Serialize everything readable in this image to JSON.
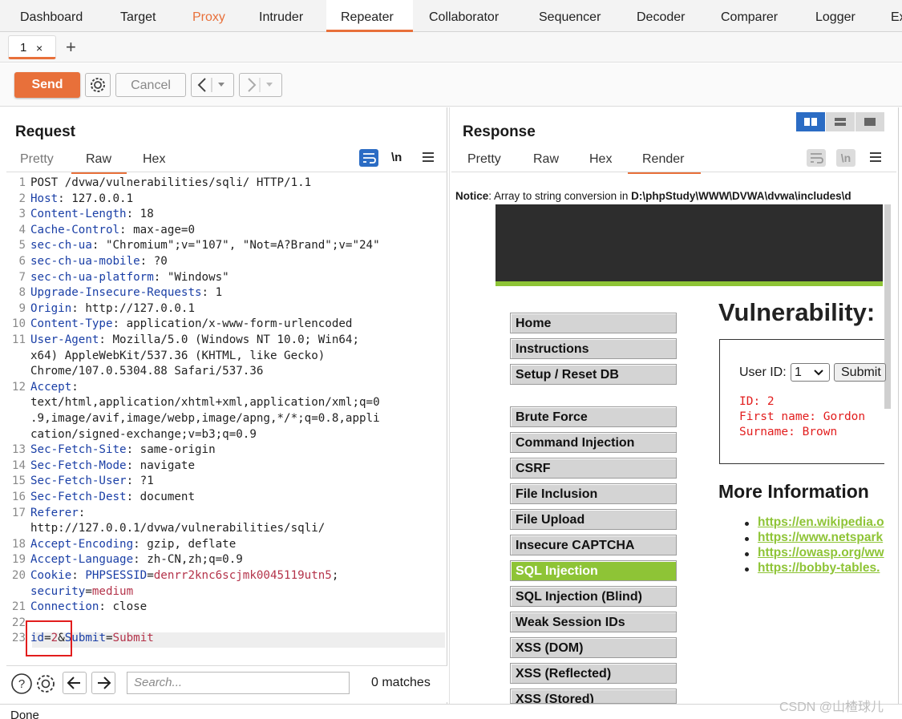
{
  "top_tabs": [
    "Dashboard",
    "Target",
    "Proxy",
    "Intruder",
    "Repeater",
    "Collaborator",
    "Sequencer",
    "Decoder",
    "Comparer",
    "Logger",
    "Ex"
  ],
  "sub_tab": {
    "label": "1",
    "close": "×",
    "add": "+"
  },
  "toolbar": {
    "send": "Send",
    "cancel": "Cancel"
  },
  "request": {
    "title": "Request",
    "tabs": [
      "Pretty",
      "Raw",
      "Hex"
    ],
    "active_tab": "Raw",
    "newline_toggle": "\\n",
    "lines": [
      {
        "n": "1",
        "segs": [
          {
            "t": "POST /dvwa/vulnerabilities/sqli/ HTTP/1.1",
            "c": "hv"
          }
        ]
      },
      {
        "n": "2",
        "segs": [
          {
            "t": "Host",
            "c": "hk"
          },
          {
            "t": ": 127.0.0.1",
            "c": "hv"
          }
        ]
      },
      {
        "n": "3",
        "segs": [
          {
            "t": "Content-Length",
            "c": "hk"
          },
          {
            "t": ": 18",
            "c": "hv"
          }
        ]
      },
      {
        "n": "4",
        "segs": [
          {
            "t": "Cache-Control",
            "c": "hk"
          },
          {
            "t": ": max-age=0",
            "c": "hv"
          }
        ]
      },
      {
        "n": "5",
        "segs": [
          {
            "t": "sec-ch-ua",
            "c": "hk"
          },
          {
            "t": ": \"Chromium\";v=\"107\", \"Not=A?Brand\";v=\"24\"",
            "c": "hv"
          }
        ]
      },
      {
        "n": "6",
        "segs": [
          {
            "t": "sec-ch-ua-mobile",
            "c": "hk"
          },
          {
            "t": ": ?0",
            "c": "hv"
          }
        ]
      },
      {
        "n": "7",
        "segs": [
          {
            "t": "sec-ch-ua-platform",
            "c": "hk"
          },
          {
            "t": ": \"Windows\"",
            "c": "hv"
          }
        ]
      },
      {
        "n": "8",
        "segs": [
          {
            "t": "Upgrade-Insecure-Requests",
            "c": "hk"
          },
          {
            "t": ": 1",
            "c": "hv"
          }
        ]
      },
      {
        "n": "9",
        "segs": [
          {
            "t": "Origin",
            "c": "hk"
          },
          {
            "t": ": http://127.0.0.1",
            "c": "hv"
          }
        ]
      },
      {
        "n": "10",
        "segs": [
          {
            "t": "Content-Type",
            "c": "hk"
          },
          {
            "t": ": application/x-www-form-urlencoded",
            "c": "hv"
          }
        ]
      },
      {
        "n": "11",
        "segs": [
          {
            "t": "User-Agent",
            "c": "hk"
          },
          {
            "t": ": Mozilla/5.0 (Windows NT 10.0; Win64;",
            "c": "hv"
          }
        ]
      },
      {
        "n": "",
        "segs": [
          {
            "t": "x64) AppleWebKit/537.36 (KHTML, like Gecko)",
            "c": "hv"
          }
        ]
      },
      {
        "n": "",
        "segs": [
          {
            "t": "Chrome/107.0.5304.88 Safari/537.36",
            "c": "hv"
          }
        ]
      },
      {
        "n": "12",
        "segs": [
          {
            "t": "Accept",
            "c": "hk"
          },
          {
            "t": ":",
            "c": "hv"
          }
        ]
      },
      {
        "n": "",
        "segs": [
          {
            "t": "text/html,application/xhtml+xml,application/xml;q=0",
            "c": "hv"
          }
        ]
      },
      {
        "n": "",
        "segs": [
          {
            "t": ".9,image/avif,image/webp,image/apng,*/*;q=0.8,appli",
            "c": "hv"
          }
        ]
      },
      {
        "n": "",
        "segs": [
          {
            "t": "cation/signed-exchange;v=b3;q=0.9",
            "c": "hv"
          }
        ]
      },
      {
        "n": "13",
        "segs": [
          {
            "t": "Sec-Fetch-Site",
            "c": "hk"
          },
          {
            "t": ": same-origin",
            "c": "hv"
          }
        ]
      },
      {
        "n": "14",
        "segs": [
          {
            "t": "Sec-Fetch-Mode",
            "c": "hk"
          },
          {
            "t": ": navigate",
            "c": "hv"
          }
        ]
      },
      {
        "n": "15",
        "segs": [
          {
            "t": "Sec-Fetch-User",
            "c": "hk"
          },
          {
            "t": ": ?1",
            "c": "hv"
          }
        ]
      },
      {
        "n": "16",
        "segs": [
          {
            "t": "Sec-Fetch-Dest",
            "c": "hk"
          },
          {
            "t": ": document",
            "c": "hv"
          }
        ]
      },
      {
        "n": "17",
        "segs": [
          {
            "t": "Referer",
            "c": "hk"
          },
          {
            "t": ":",
            "c": "hv"
          }
        ]
      },
      {
        "n": "",
        "segs": [
          {
            "t": "http://127.0.0.1/dvwa/vulnerabilities/sqli/",
            "c": "hv"
          }
        ]
      },
      {
        "n": "18",
        "segs": [
          {
            "t": "Accept-Encoding",
            "c": "hk"
          },
          {
            "t": ": gzip, deflate",
            "c": "hv"
          }
        ]
      },
      {
        "n": "19",
        "segs": [
          {
            "t": "Accept-Language",
            "c": "hk"
          },
          {
            "t": ": zh-CN,zh;q=0.9",
            "c": "hv"
          }
        ]
      },
      {
        "n": "20",
        "segs": [
          {
            "t": "Cookie",
            "c": "hk"
          },
          {
            "t": ": ",
            "c": "hv"
          },
          {
            "t": "PHPSESSID",
            "c": "hk"
          },
          {
            "t": "=",
            "c": "hv"
          },
          {
            "t": "denrr2knc6scjmk0045119utn5",
            "c": "ck"
          },
          {
            "t": ";",
            "c": "hv"
          }
        ]
      },
      {
        "n": "",
        "segs": [
          {
            "t": "security",
            "c": "hk"
          },
          {
            "t": "=",
            "c": "hv"
          },
          {
            "t": "medium",
            "c": "ck"
          }
        ]
      },
      {
        "n": "21",
        "segs": [
          {
            "t": "Connection",
            "c": "hk"
          },
          {
            "t": ": close",
            "c": "hv"
          }
        ]
      },
      {
        "n": "22",
        "segs": []
      },
      {
        "n": "23",
        "segs": [
          {
            "t": "id",
            "c": "hk"
          },
          {
            "t": "=",
            "c": "hv"
          },
          {
            "t": "2",
            "c": "ck"
          },
          {
            "t": "&",
            "c": "hv"
          },
          {
            "t": "Submit",
            "c": "hk"
          },
          {
            "t": "=",
            "c": "hv"
          },
          {
            "t": "Submit",
            "c": "ck"
          }
        ]
      }
    ]
  },
  "search": {
    "placeholder": "Search...",
    "matches": "0 matches"
  },
  "response": {
    "title": "Response",
    "tabs": [
      "Pretty",
      "Raw",
      "Hex",
      "Render"
    ],
    "active_tab": "Render",
    "newline_toggle": "\\n"
  },
  "render": {
    "notice_label": "Notice",
    "notice_text": ": Array to string conversion in ",
    "notice_path": "D:\\phpStudy\\WWW\\DVWA\\dvwa\\includes\\d",
    "menu": [
      "Home",
      "Instructions",
      "Setup / Reset DB",
      "Brute Force",
      "Command Injection",
      "CSRF",
      "File Inclusion",
      "File Upload",
      "Insecure CAPTCHA",
      "SQL Injection",
      "SQL Injection (Blind)",
      "Weak Session IDs",
      "XSS (DOM)",
      "XSS (Reflected)",
      "XSS (Stored)"
    ],
    "selected_menu": "SQL Injection",
    "heading": "Vulnerability:",
    "userid_label": "User ID:",
    "userid_value": "1",
    "submit": "Submit",
    "result": [
      "ID: 2",
      "First name: Gordon",
      "Surname: Brown"
    ],
    "more_info": "More Information",
    "links": [
      "https://en.wikipedia.o",
      "https://www.netspark",
      "https://owasp.org/ww",
      "https://bobby-tables."
    ]
  },
  "status": {
    "text": "Done"
  },
  "watermark": "CSDN @山楂球儿",
  "colors": {
    "accent": "#e8703a",
    "dvwa_green": "#8ec436",
    "result_red": "#e21d1d",
    "header_key_blue": "#1a3fa6",
    "value_red": "#b4334a"
  }
}
